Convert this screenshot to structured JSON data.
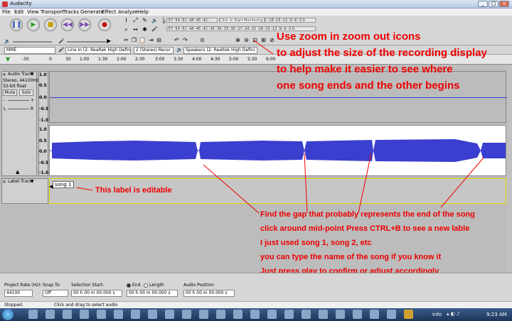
{
  "window": {
    "title": "Audacity"
  },
  "menu": [
    "File",
    "Edit",
    "View",
    "Transport",
    "Tracks",
    "Generate",
    "Effect",
    "Analyze",
    "Help"
  ],
  "meters": {
    "play_scale": "-57 -54 -51 -48 -45 -42 -",
    "play_channel_top": "L",
    "play_channel_bottom": "R",
    "record_prompt": "Click to Start Monitoring",
    "record_scale_tail": "! -18 -15 -12 -9 -6 -3 0",
    "second_scale": "-57 -54 -51 -48 -45 -42 -39 -36 -33 -30 -27 -24 -21 -18 -15 -12 -9 -6 -3 0"
  },
  "devices": {
    "host": "MME",
    "input": "Line In (2- Realtek High Defini",
    "channels": "2 (Stereo) Recor",
    "output": "Speakers (2- Realtek High Defini"
  },
  "ruler": [
    "-30",
    "0",
    "30",
    "1:00",
    "1:30",
    "2:00",
    "2:30",
    "3:00",
    "3:30",
    "4:00",
    "4:30",
    "5:00",
    "5:30",
    "6:00"
  ],
  "audio_track": {
    "name": "Audio Track",
    "format1": "Stereo, 44100Hz",
    "format2": "32-bit float",
    "mute": "Mute",
    "solo": "Solo",
    "gain_minus": "-",
    "gain_plus": "+",
    "pan_left": "L",
    "pan_right": "R",
    "axis": [
      "1.0",
      "0.5",
      "0.0",
      "-0.5",
      "-1.0"
    ],
    "axis2": [
      "1.0",
      "0.5",
      "0.0",
      "-0.5",
      "-1.0"
    ]
  },
  "label_track": {
    "name": "Label Track",
    "label": "song 1"
  },
  "annotations": {
    "zoom": [
      "Use zoom in zoom out icons",
      "to adjust the size of the recording display",
      "to help make it easier to see where",
      "one song ends and the other begins"
    ],
    "label": "This label is editable",
    "gap": [
      "Find the gap that probably represents the end of the song",
      "click around mid-point Press CTRL+B to see a new lable",
      "I just used song 1, song 2, etc",
      "you can type the name of the song if you know it",
      "Just press play to confirm or adjust accordingly"
    ]
  },
  "selection": {
    "rate_label": "Project Rate (Hz):",
    "rate_value": "44100",
    "snap_label": "Snap To:",
    "snap_value": "Off",
    "start_label": "Selection Start:",
    "start_value": "00 h 00 m 00.000 s",
    "end_option": "End",
    "length_option": "Length",
    "end_value": "00 h 00 m 00.000 s",
    "pos_label": "Audio Position:",
    "pos_value": "00 h 00 m 00.000 s"
  },
  "status": {
    "left": "Stopped.",
    "hint": "Click and drag to select audio"
  },
  "taskbar": {
    "info": "info",
    "time": "9:23 AM"
  },
  "colors": {
    "waveform": "#3a3fcf",
    "annotation": "#e00000"
  }
}
